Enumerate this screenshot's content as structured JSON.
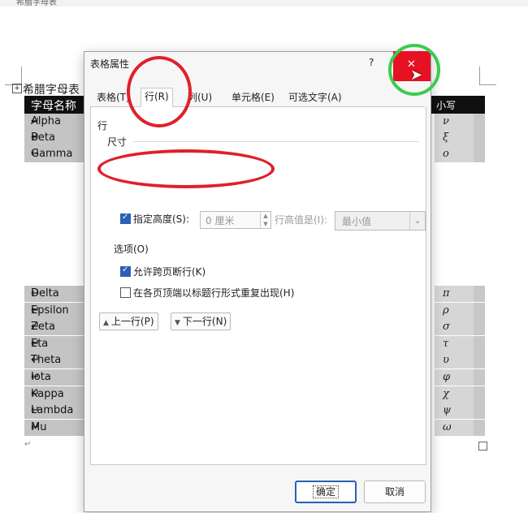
{
  "window": {
    "strip_title": "希腊字母表"
  },
  "document": {
    "caption": "希腊字母表",
    "table_header": {
      "col1": "字母名称",
      "col_right": "小写"
    },
    "rows_top": [
      {
        "name": "Alpha",
        "symbol": "ν"
      },
      {
        "name": "Beta",
        "symbol": "ξ"
      },
      {
        "name": "Gamma",
        "symbol": "ο"
      }
    ],
    "rows_bottom": [
      {
        "name": "Delta",
        "symbol": "π"
      },
      {
        "name": "Epsilon",
        "symbol": "ρ"
      },
      {
        "name": "Zeta",
        "symbol": "σ"
      },
      {
        "name": "Eta",
        "symbol": "τ"
      },
      {
        "name": "Theta",
        "symbol": "υ"
      },
      {
        "name": "Iota",
        "symbol": "φ"
      },
      {
        "name": "Kappa",
        "symbol": "χ"
      },
      {
        "name": "Lambda",
        "symbol": "ψ"
      },
      {
        "name": "Mu",
        "symbol": "ω"
      }
    ],
    "cell_mark": "↵",
    "paragraph_mark": "↵"
  },
  "dialog": {
    "title": "表格属性",
    "help": "?",
    "close": "✕",
    "tabs": [
      "表格(T)",
      "行(R)",
      "列(U)",
      "单元格(E)",
      "可选文字(A)"
    ],
    "active_tab": "行(R)",
    "section_row": "行",
    "section_size": "尺寸",
    "specify_height_label": "指定高度(S):",
    "specify_height_checked": true,
    "height_value": "0 厘米",
    "row_height_mode_label": "行高值是(I):",
    "row_height_mode_value": "最小值",
    "section_options": "选项(O)",
    "allow_break_label": "允许跨页断行(K)",
    "allow_break_checked": true,
    "repeat_header_label": "在各页顶端以标题行形式重复出现(H)",
    "repeat_header_checked": false,
    "prev_row": "上一行(P)",
    "next_row": "下一行(N)",
    "ok": "确定",
    "cancel": "取消"
  },
  "colors": {
    "close_red": "#e81123",
    "annotation_red": "#e0202a",
    "annotation_green": "#3ccb4f",
    "accent_blue": "#2b5fb8"
  }
}
